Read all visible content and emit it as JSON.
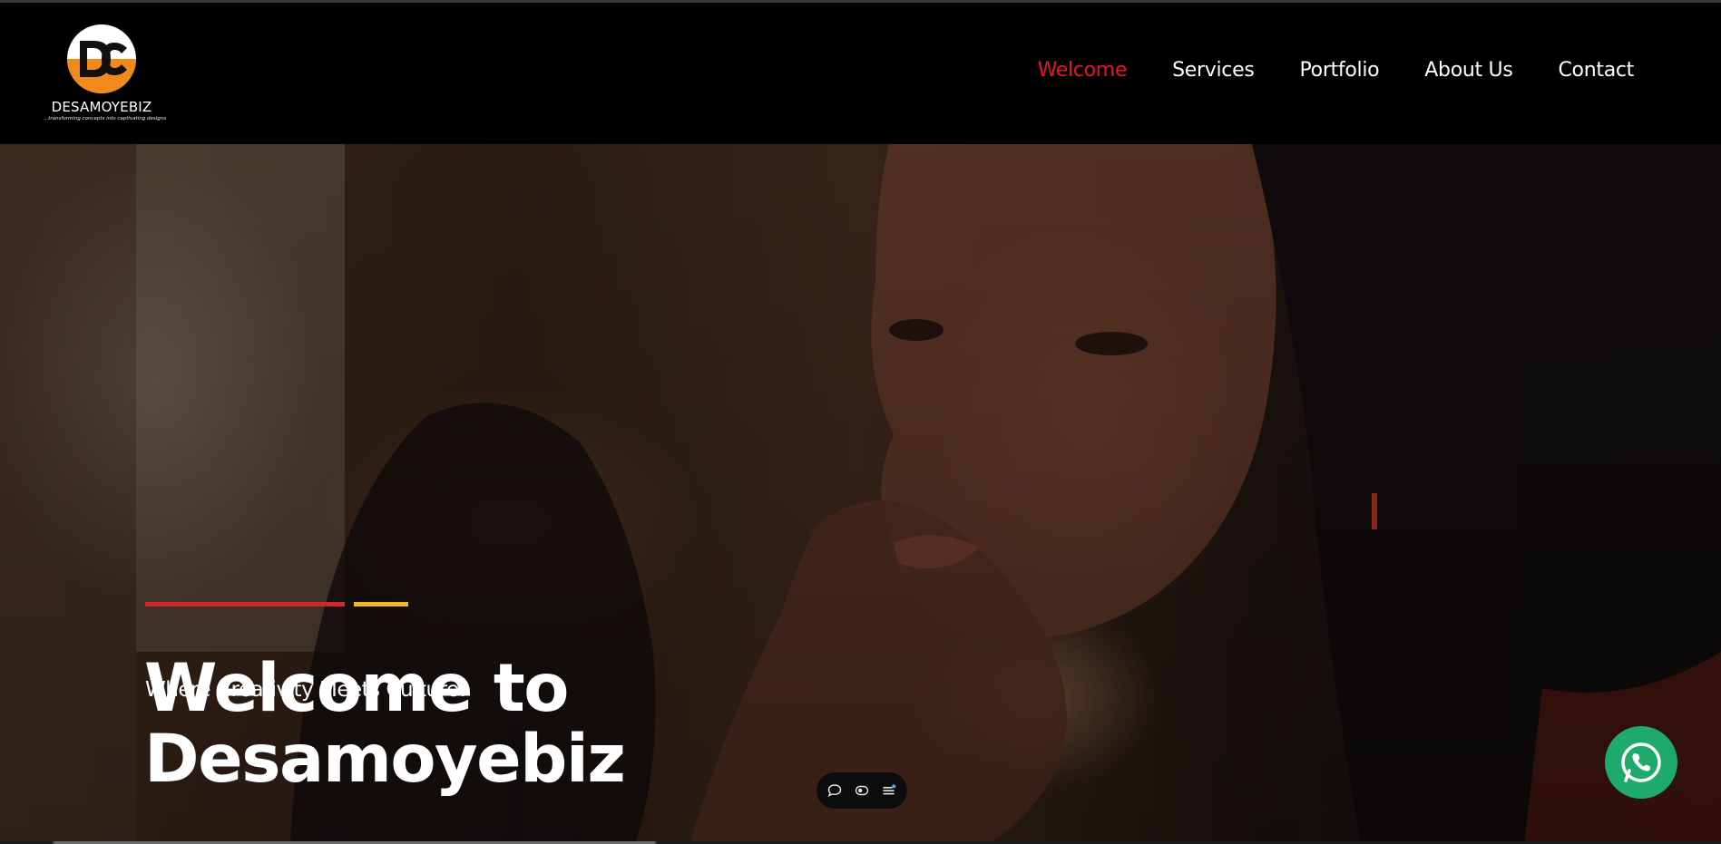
{
  "brand": {
    "name": "DESAMOYEBIZ",
    "tagline": "...transforming concepts into captivating designs",
    "logo_letters": "DC",
    "logo_colors": {
      "circle": "#ffffff",
      "accent": "#f08a1a"
    }
  },
  "nav": {
    "items": [
      {
        "label": "Welcome",
        "active": true
      },
      {
        "label": "Services",
        "active": false
      },
      {
        "label": "Portfolio",
        "active": false
      },
      {
        "label": "About Us",
        "active": false
      },
      {
        "label": "Contact",
        "active": false
      }
    ],
    "active_color": "#e6132b"
  },
  "hero": {
    "title_line1": "Welcome to",
    "title_line2": "Desamoyebiz",
    "subtitle": "Where Creativity Meets Culture!",
    "accent_colors": {
      "primary": "#d4262a",
      "secondary": "#f0b823"
    }
  },
  "floating_toolbar": {
    "icons": [
      "chat-bubble-icon",
      "eye-toggle-icon",
      "list-menu-icon"
    ]
  },
  "whatsapp": {
    "icon": "whatsapp-phone-icon",
    "color": "#1eaa6a"
  }
}
